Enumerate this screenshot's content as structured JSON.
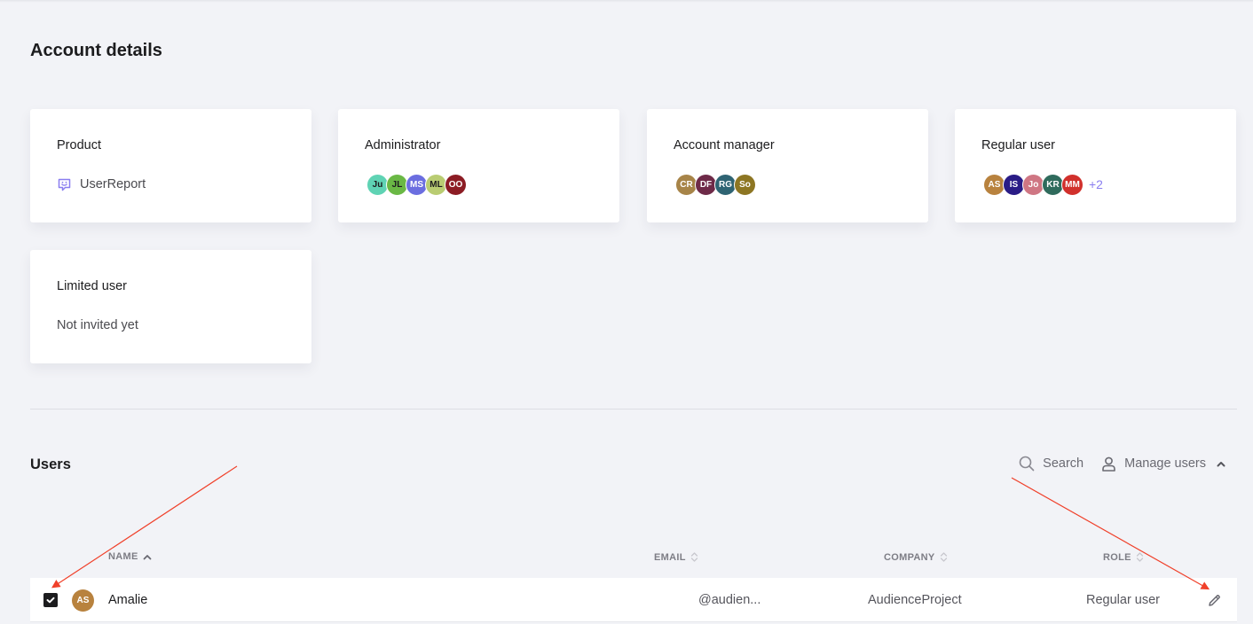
{
  "page": {
    "title": "Account details"
  },
  "cards": [
    {
      "title": "Product",
      "type": "product",
      "product": {
        "icon": "chat-smile-icon",
        "name": "UserReport",
        "icon_color": "#8a7ef0"
      }
    },
    {
      "title": "Administrator",
      "type": "avatars",
      "avatars": [
        {
          "initials": "Ju",
          "color": "#5fd3b4",
          "dark_text": true
        },
        {
          "initials": "JL",
          "color": "#6ab845",
          "dark_text": true
        },
        {
          "initials": "MS",
          "color": "#6b6ee0",
          "dark_text": false
        },
        {
          "initials": "ML",
          "color": "#b9cc72",
          "dark_text": true
        },
        {
          "initials": "OO",
          "color": "#8c1c24",
          "dark_text": false
        }
      ]
    },
    {
      "title": "Account manager",
      "type": "avatars",
      "avatars": [
        {
          "initials": "CR",
          "color": "#a78448",
          "dark_text": false
        },
        {
          "initials": "DF",
          "color": "#6e2a48",
          "dark_text": false
        },
        {
          "initials": "RG",
          "color": "#2f6473",
          "dark_text": false
        },
        {
          "initials": "So",
          "color": "#8d7623",
          "dark_text": false
        }
      ]
    },
    {
      "title": "Regular user",
      "type": "avatars",
      "avatars": [
        {
          "initials": "AS",
          "color": "#b8823e",
          "dark_text": false
        },
        {
          "initials": "IS",
          "color": "#2a1c86",
          "dark_text": false
        },
        {
          "initials": "Jo",
          "color": "#cf7683",
          "dark_text": false
        },
        {
          "initials": "KR",
          "color": "#2f6b5c",
          "dark_text": false
        },
        {
          "initials": "MM",
          "color": "#d1302c",
          "dark_text": false
        }
      ],
      "more": "+2"
    },
    {
      "title": "Limited user",
      "type": "text",
      "text": "Not invited yet"
    }
  ],
  "users": {
    "title": "Users",
    "search_label": "Search",
    "manage_label": "Manage users",
    "columns": {
      "name": "NAME",
      "email": "EMAIL",
      "company": "COMPANY",
      "role": "ROLE"
    },
    "rows": [
      {
        "checked": true,
        "initials": "AS",
        "avatar_color": "#b8823e",
        "name": "Amalie",
        "email": "@audien...",
        "company": "AudienceProject",
        "role": "Regular user"
      }
    ]
  },
  "colors": {
    "accent": "#8a7ef0",
    "background": "#f2f3f7",
    "annotation_arrow": "#f0402a"
  }
}
